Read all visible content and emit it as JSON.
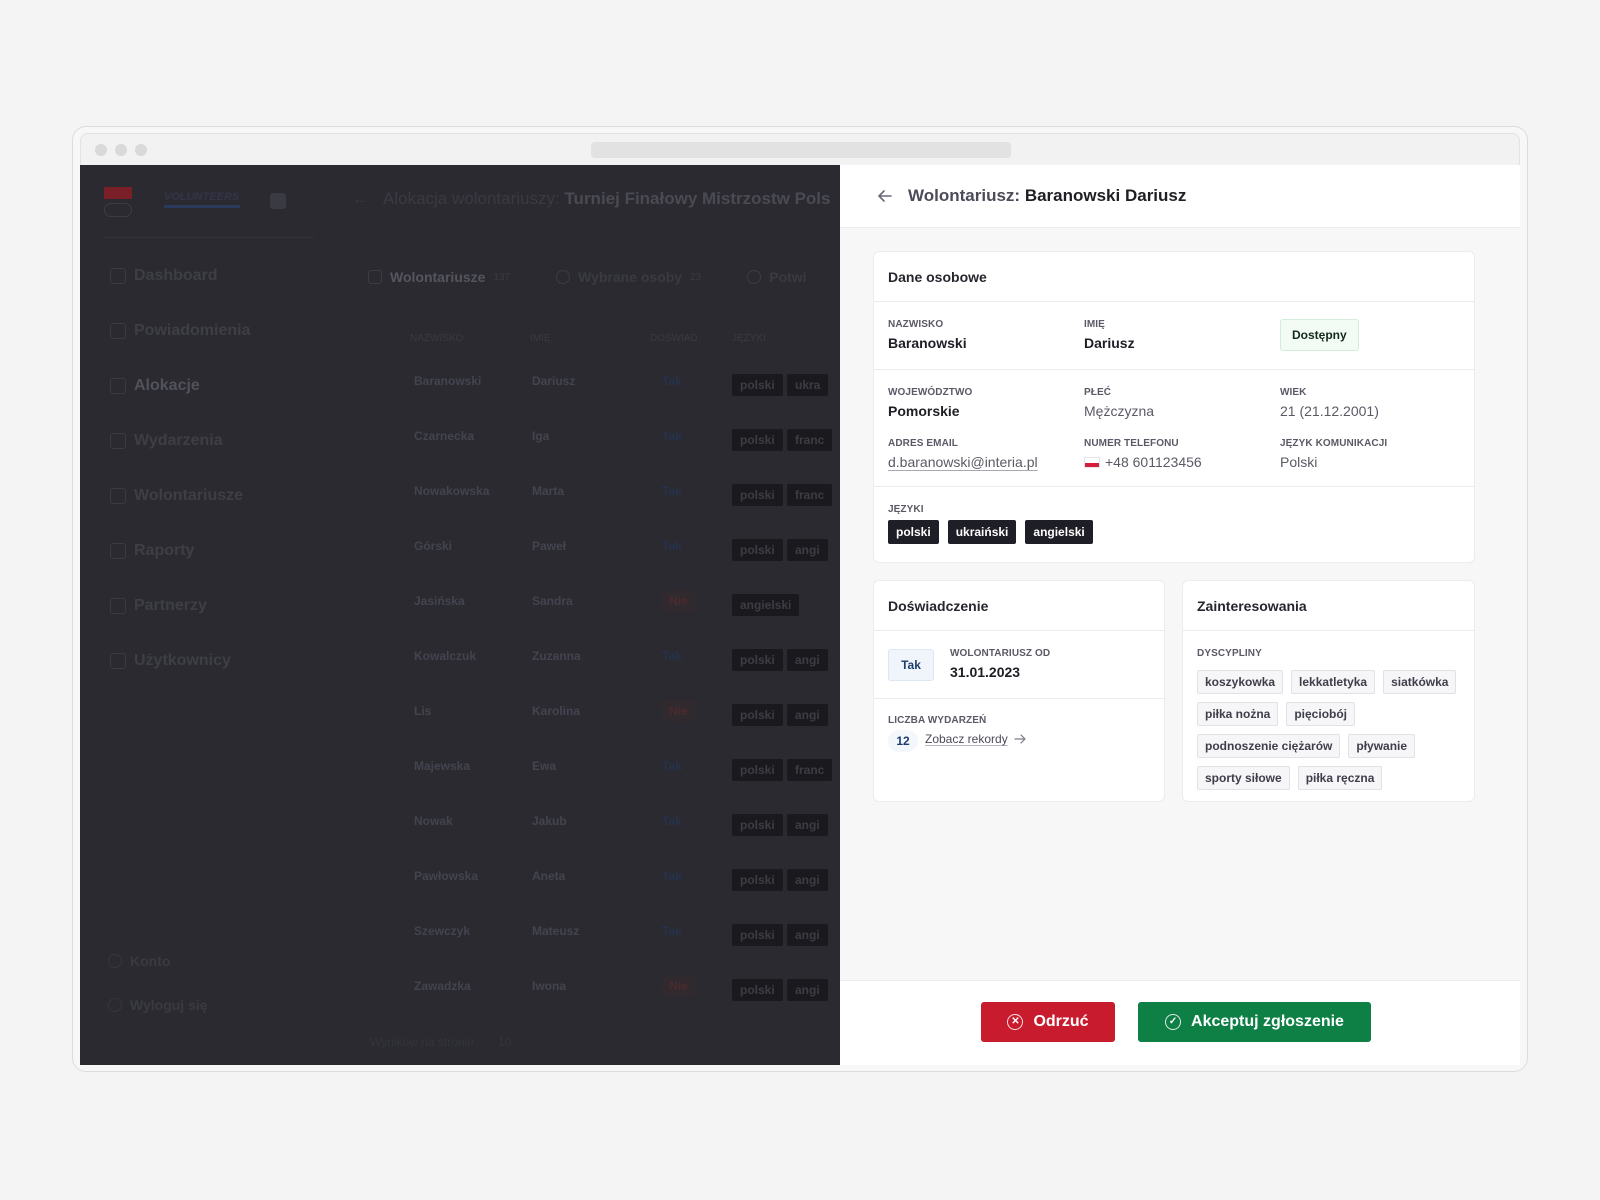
{
  "background_app": {
    "logo_text": "VOLUNTEERS",
    "header_prefix": "Alokacja wolontariuszy:",
    "header_event": "Turniej Finałowy Mistrzostw Pols",
    "nav": [
      "Dashboard",
      "Powiadomienia",
      "Alokacje",
      "Wydarzenia",
      "Wolontariusze",
      "Raporty",
      "Partnerzy",
      "Użytkownicy"
    ],
    "nav_active": "Alokacje",
    "footer_nav": [
      "Konto",
      "Wyloguj się"
    ],
    "tabs": [
      {
        "label": "Wolontariusze",
        "count": "137"
      },
      {
        "label": "Wybrane osoby",
        "count": "23"
      },
      {
        "label": "Potwi",
        "count": ""
      }
    ],
    "columns": [
      "NAZWISKO",
      "IMIĘ",
      "DOŚWIAD.",
      "JĘZYKI"
    ],
    "rows": [
      {
        "last": "Baranowski",
        "first": "Dariusz",
        "exp": "Tak",
        "langs": [
          "polski",
          "ukra"
        ]
      },
      {
        "last": "Czarnecka",
        "first": "Iga",
        "exp": "Tak",
        "langs": [
          "polski",
          "franc"
        ]
      },
      {
        "last": "Nowakowska",
        "first": "Marta",
        "exp": "Tak",
        "langs": [
          "polski",
          "franc"
        ]
      },
      {
        "last": "Górski",
        "first": "Paweł",
        "exp": "Tak",
        "langs": [
          "polski",
          "angi"
        ]
      },
      {
        "last": "Jasińska",
        "first": "Sandra",
        "exp": "Nie",
        "langs": [
          "angielski"
        ]
      },
      {
        "last": "Kowalczuk",
        "first": "Zuzanna",
        "exp": "Tak",
        "langs": [
          "polski",
          "angi"
        ]
      },
      {
        "last": "Lis",
        "first": "Karolina",
        "exp": "Nie",
        "langs": [
          "polski",
          "angi"
        ]
      },
      {
        "last": "Majewska",
        "first": "Ewa",
        "exp": "Tak",
        "langs": [
          "polski",
          "franc"
        ]
      },
      {
        "last": "Nowak",
        "first": "Jakub",
        "exp": "Tak",
        "langs": [
          "polski",
          "angi"
        ]
      },
      {
        "last": "Pawłowska",
        "first": "Aneta",
        "exp": "Tak",
        "langs": [
          "polski",
          "angi"
        ]
      },
      {
        "last": "Szewczyk",
        "first": "Mateusz",
        "exp": "Tak",
        "langs": [
          "polski",
          "angi"
        ]
      },
      {
        "last": "Zawadzka",
        "first": "Iwona",
        "exp": "Nie",
        "langs": [
          "polski",
          "angi"
        ]
      }
    ],
    "pagination_label": "Wyników na stronie",
    "pagination_value": "10"
  },
  "panel": {
    "title_prefix": "Wolontariusz:",
    "title_name": "Baranowski Dariusz",
    "personal": {
      "heading": "Dane osobowe",
      "surname_label": "NAZWISKO",
      "surname": "Baranowski",
      "name_label": "IMIĘ",
      "name": "Dariusz",
      "status": "Dostępny",
      "region_label": "WOJEWÓDZTWO",
      "region": "Pomorskie",
      "sex_label": "PŁEĆ",
      "sex": "Mężczyzna",
      "age_label": "WIEK",
      "age": "21 (21.12.2001)",
      "email_label": "ADRES EMAIL",
      "email": "d.baranowski@interia.pl",
      "phone_label": "NUMER TELEFONU",
      "phone": "+48 601123456",
      "comm_lang_label": "JĘZYK KOMUNIKACJI",
      "comm_lang": "Polski",
      "languages_label": "JĘZYKI",
      "languages": [
        "polski",
        "ukraiński",
        "angielski"
      ]
    },
    "experience": {
      "heading": "Doświadczenie",
      "has_experience": "Tak",
      "since_label": "WOLONTARIUSZ OD",
      "since": "31.01.2023",
      "events_label": "LICZBA WYDARZEŃ",
      "events_count": "12",
      "records_link": "Zobacz rekordy"
    },
    "interests": {
      "heading": "Zainteresowania",
      "disciplines_label": "DYSCYPLINY",
      "disciplines": [
        "koszykowka",
        "lekkatletyka",
        "siatkówka",
        "piłka nożna",
        "pięciobój",
        "podnoszenie ciężarów",
        "pływanie",
        "sporty siłowe",
        "piłka ręczna"
      ]
    },
    "actions": {
      "reject": "Odrzuć",
      "accept": "Akceptuj zgłoszenie"
    }
  },
  "colors": {
    "reject": "#c81c2e",
    "accept": "#0e8046",
    "overlay": "#2a2a30",
    "status_ok_bg": "#f3fbf5"
  }
}
